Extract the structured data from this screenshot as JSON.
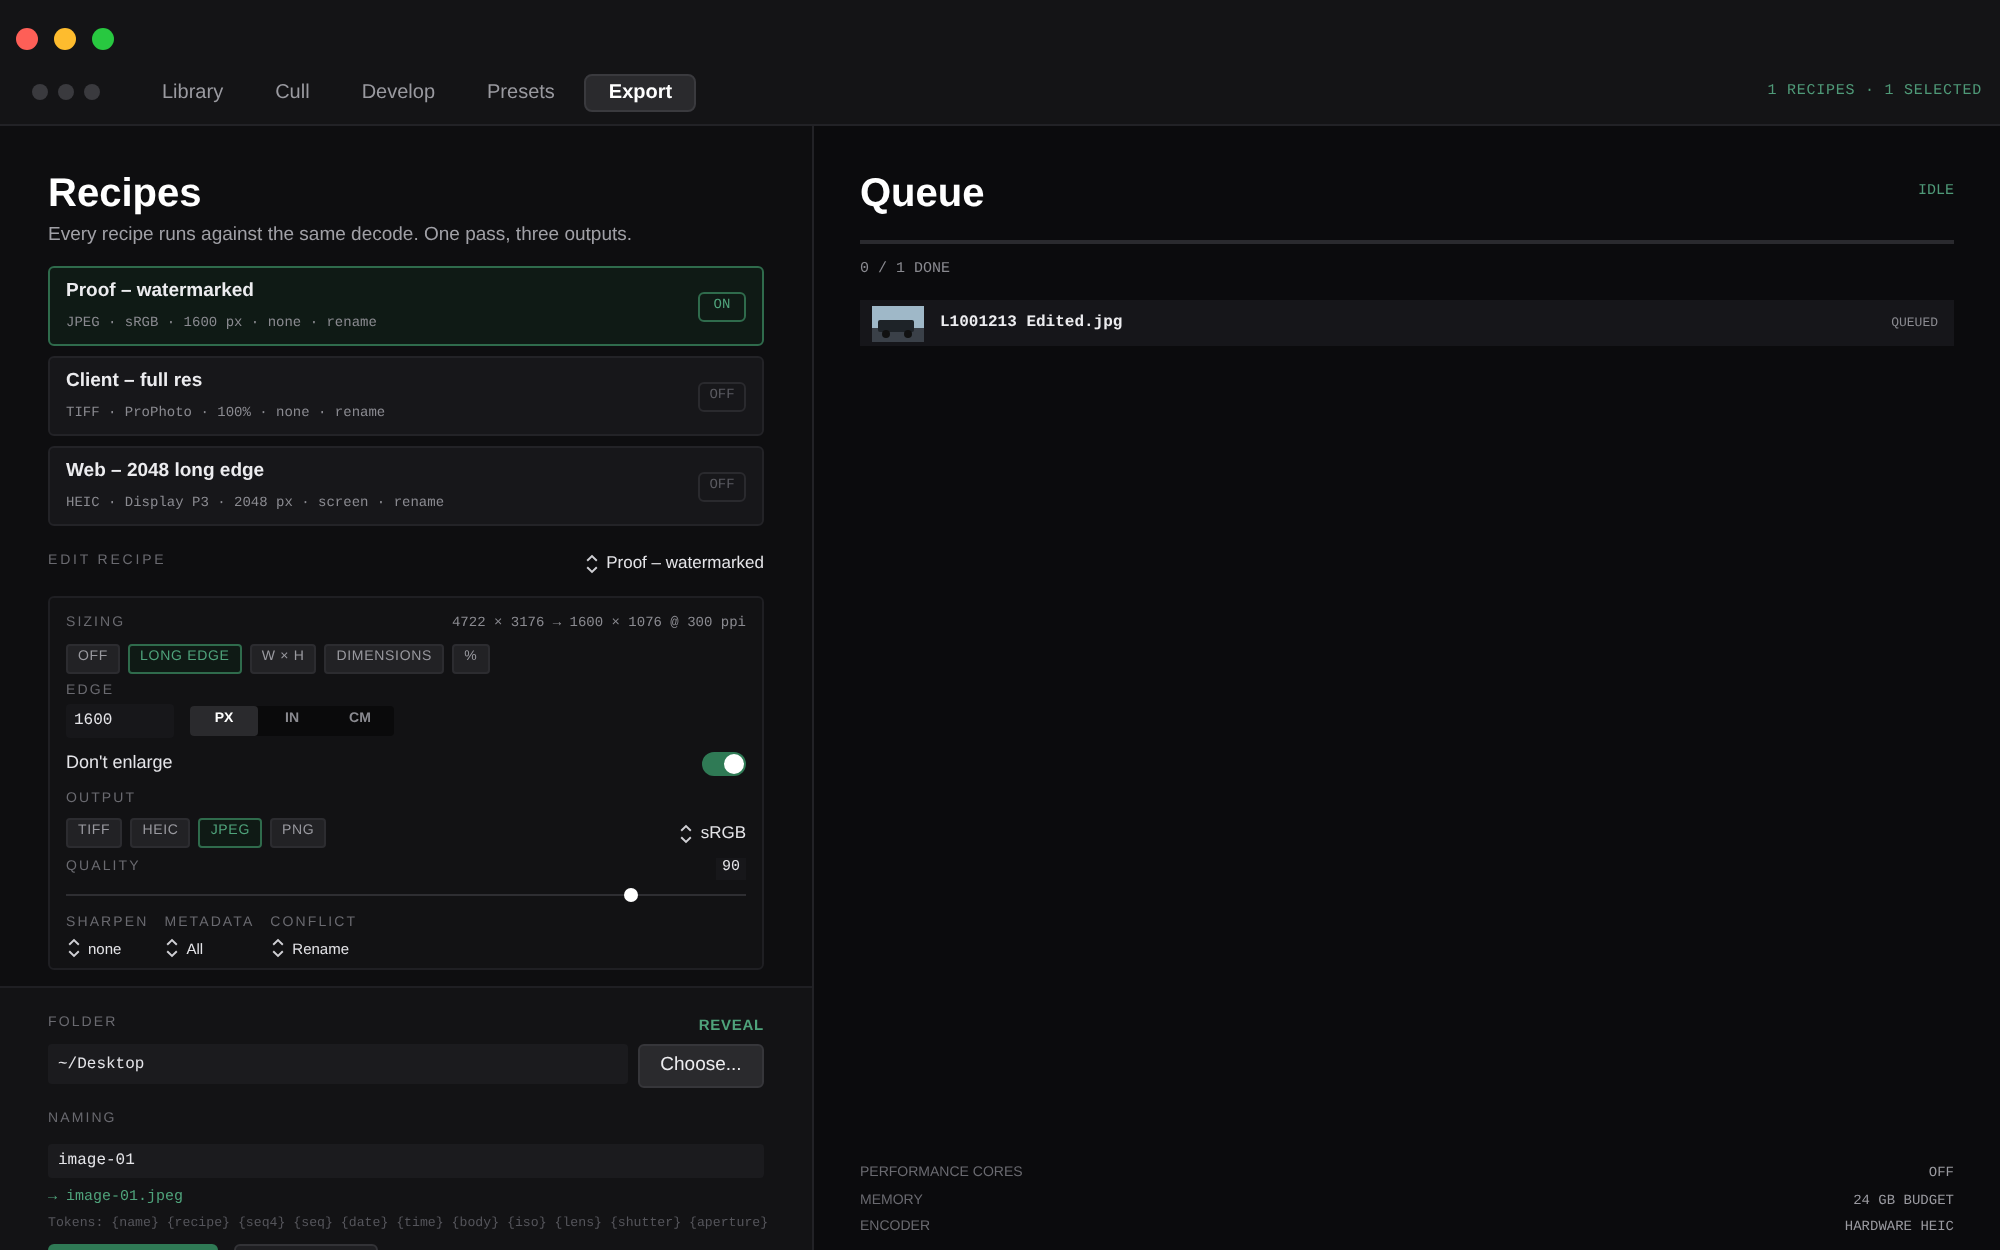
{
  "tabs": [
    {
      "label": "Library",
      "selected": false
    },
    {
      "label": "Cull",
      "selected": false
    },
    {
      "label": "Develop",
      "selected": false
    },
    {
      "label": "Presets",
      "selected": false
    },
    {
      "label": "Export",
      "selected": true
    }
  ],
  "header_status": "1 RECIPES · 1 SELECTED",
  "recipes": {
    "title": "Recipes",
    "subtitle": "Every recipe runs against the same decode. One pass, three outputs.",
    "items": [
      {
        "name": "Proof – watermarked",
        "details": "JPEG · sRGB · 1600 px · none · rename",
        "toggle": "ON",
        "on": true,
        "selected": true
      },
      {
        "name": "Client – full res",
        "details": "TIFF · ProPhoto · 100% · none · rename",
        "toggle": "OFF",
        "on": false,
        "selected": false
      },
      {
        "name": "Web – 2048 long edge",
        "details": "HEIC · Display P3 · 2048 px · screen · rename",
        "toggle": "OFF",
        "on": false,
        "selected": false
      }
    ]
  },
  "edit_recipe": {
    "label": "EDIT RECIPE",
    "recipe_picker": "Proof – watermarked",
    "sizing": {
      "label": "SIZING",
      "info": "4722 × 3176 → 1600 × 1076 @ 300 ppi",
      "modes": [
        {
          "label": "OFF",
          "selected": false
        },
        {
          "label": "LONG EDGE",
          "selected": true
        },
        {
          "label": "W × H",
          "selected": false
        },
        {
          "label": "DIMENSIONS",
          "selected": false
        },
        {
          "label": "%",
          "selected": false
        }
      ],
      "edge_label": "EDGE",
      "edge_value": "1600",
      "units": [
        {
          "label": "PX",
          "selected": true
        },
        {
          "label": "IN",
          "selected": false
        },
        {
          "label": "CM",
          "selected": false
        }
      ]
    },
    "dont_enlarge": {
      "label": "Don't enlarge",
      "on": true
    },
    "output": {
      "label": "OUTPUT",
      "formats": [
        {
          "label": "TIFF",
          "selected": false
        },
        {
          "label": "HEIC",
          "selected": false
        },
        {
          "label": "JPEG",
          "selected": true
        },
        {
          "label": "PNG",
          "selected": false
        }
      ],
      "color_space": "sRGB"
    },
    "quality": {
      "label": "QUALITY",
      "value": "90",
      "level": 0.83
    },
    "selects": [
      {
        "label": "SHARPEN",
        "value": "none"
      },
      {
        "label": "METADATA",
        "value": "All"
      },
      {
        "label": "CONFLICT",
        "value": "Rename"
      }
    ]
  },
  "footer": {
    "folder_label": "FOLDER",
    "reveal": "REVEAL",
    "folder_value": "~/Desktop",
    "choose_button": "Choose...",
    "naming_label": "NAMING",
    "naming_value": "image-01",
    "preview": "→ image-01.jpeg",
    "tokens": "Tokens: {name} {recipe} {seq4} {seq} {date} {time} {body} {iso} {lens} {shutter} {aperture}"
  },
  "queue": {
    "title": "Queue",
    "status": "IDLE",
    "progress": {
      "level": 0
    },
    "done_label": "0 / 1 DONE",
    "items": [
      {
        "name": "L1001213 Edited.jpg",
        "status": "QUEUED"
      }
    ],
    "stats": [
      {
        "label": "PERFORMANCE CORES",
        "value": "OFF"
      },
      {
        "label": "MEMORY",
        "value": "24 GB BUDGET"
      },
      {
        "label": "ENCODER",
        "value": "HARDWARE HEIC"
      }
    ]
  }
}
